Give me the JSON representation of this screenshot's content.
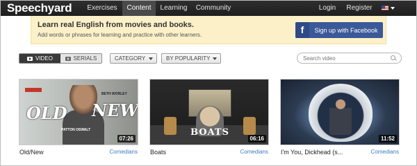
{
  "app": {
    "logo": "Speechyard"
  },
  "nav": {
    "items": [
      {
        "label": "Exercises",
        "active": false
      },
      {
        "label": "Content",
        "active": true
      },
      {
        "label": "Learning",
        "active": false
      },
      {
        "label": "Community",
        "active": false
      }
    ],
    "login": "Login",
    "register": "Register",
    "language_icon": "us-flag-icon"
  },
  "promo": {
    "title": "Learn real English from movies and books.",
    "subtitle": "Add words or phrases for learning and practice with other learners.",
    "facebook_button": "Sign up with Facebook",
    "facebook_color": "#3b5998"
  },
  "filters": {
    "tabs": [
      {
        "label": "VIDEO",
        "active": true
      },
      {
        "label": "SERIALS",
        "active": false
      }
    ],
    "category": "CATEGORY",
    "sort": "BY POPULARITY",
    "search_placeholder": "Search video"
  },
  "videos": [
    {
      "title": "Old/New",
      "category": "Comedians",
      "duration": "07:26",
      "thumb_text": [
        "OLD",
        "NEW",
        "BETH WORLEY",
        "PATTON OSWALT"
      ]
    },
    {
      "title": "Boats",
      "category": "Comedians",
      "duration": "06:16",
      "thumb_text": [
        "BOATS"
      ]
    },
    {
      "title": "I'm You, Dickhead (s...",
      "category": "Comedians",
      "duration": "11:52"
    }
  ],
  "colors": {
    "nav_bg": "#262626",
    "promo_bg": "#fbf0c8",
    "link": "#3a7bbf"
  }
}
